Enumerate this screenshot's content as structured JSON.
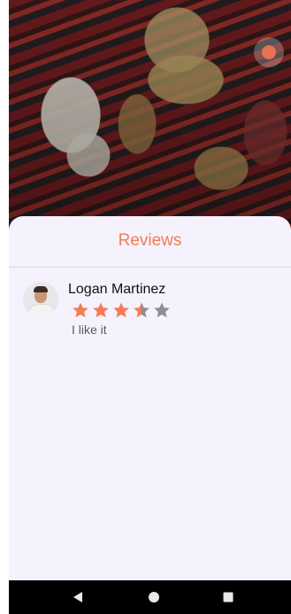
{
  "sheet": {
    "title": "Reviews"
  },
  "reviews": [
    {
      "name": "Logan Martinez",
      "rating": 3.5,
      "max_rating": 5,
      "text": "I like it"
    }
  ],
  "colors": {
    "accent": "#f47c56",
    "star_empty": "#8e8c99",
    "sheet_bg": "#f5f2fd"
  },
  "icons": {
    "favorite": "favorite-badge-icon",
    "nav_back": "back-triangle-icon",
    "nav_home": "home-circle-icon",
    "nav_recents": "recents-square-icon"
  }
}
